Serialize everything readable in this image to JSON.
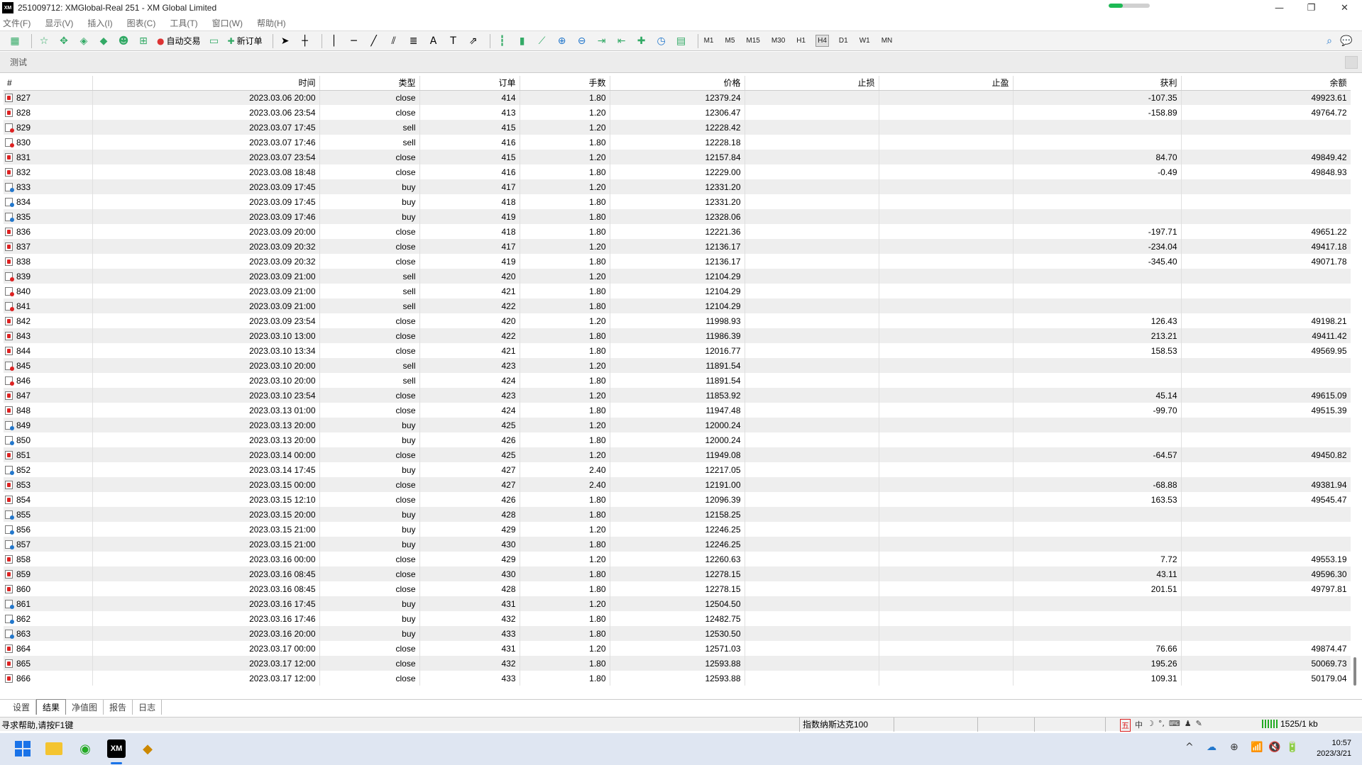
{
  "window": {
    "title": "251009712: XMGlobal-Real 251 - XM Global Limited",
    "logo": "XM",
    "progress": 0.35,
    "minimize_glyph": "—",
    "restore_glyph": "❐",
    "close_glyph": "✕"
  },
  "menu": [
    "文件(F)",
    "显示(V)",
    "插入(I)",
    "图表(C)",
    "工具(T)",
    "窗口(W)",
    "帮助(H)"
  ],
  "toolbar": {
    "autotrade_label": "自动交易",
    "new_order_label": "新订单",
    "text_tool": "A",
    "label_tool": "T",
    "timeframes": [
      "M1",
      "M5",
      "M15",
      "M30",
      "H1",
      "H4",
      "D1",
      "W1",
      "MN"
    ],
    "active_timeframe": "H4"
  },
  "subheader": {
    "label": "测试"
  },
  "table": {
    "columns": [
      "#",
      "时间",
      "类型",
      "订单",
      "手数",
      "价格",
      "止损",
      "止盈",
      "获利",
      "余额"
    ],
    "rows": [
      [
        "827",
        "2023.03.06 20:00",
        "close",
        "414",
        "1.80",
        "12379.24",
        "",
        "",
        "-107.35",
        "49923.61"
      ],
      [
        "828",
        "2023.03.06 23:54",
        "close",
        "413",
        "1.20",
        "12306.47",
        "",
        "",
        "-158.89",
        "49764.72"
      ],
      [
        "829",
        "2023.03.07 17:45",
        "sell",
        "415",
        "1.20",
        "12228.42",
        "",
        "",
        "",
        ""
      ],
      [
        "830",
        "2023.03.07 17:46",
        "sell",
        "416",
        "1.80",
        "12228.18",
        "",
        "",
        "",
        ""
      ],
      [
        "831",
        "2023.03.07 23:54",
        "close",
        "415",
        "1.20",
        "12157.84",
        "",
        "",
        "84.70",
        "49849.42"
      ],
      [
        "832",
        "2023.03.08 18:48",
        "close",
        "416",
        "1.80",
        "12229.00",
        "",
        "",
        "-0.49",
        "49848.93"
      ],
      [
        "833",
        "2023.03.09 17:45",
        "buy",
        "417",
        "1.20",
        "12331.20",
        "",
        "",
        "",
        ""
      ],
      [
        "834",
        "2023.03.09 17:45",
        "buy",
        "418",
        "1.80",
        "12331.20",
        "",
        "",
        "",
        ""
      ],
      [
        "835",
        "2023.03.09 17:46",
        "buy",
        "419",
        "1.80",
        "12328.06",
        "",
        "",
        "",
        ""
      ],
      [
        "836",
        "2023.03.09 20:00",
        "close",
        "418",
        "1.80",
        "12221.36",
        "",
        "",
        "-197.71",
        "49651.22"
      ],
      [
        "837",
        "2023.03.09 20:32",
        "close",
        "417",
        "1.20",
        "12136.17",
        "",
        "",
        "-234.04",
        "49417.18"
      ],
      [
        "838",
        "2023.03.09 20:32",
        "close",
        "419",
        "1.80",
        "12136.17",
        "",
        "",
        "-345.40",
        "49071.78"
      ],
      [
        "839",
        "2023.03.09 21:00",
        "sell",
        "420",
        "1.20",
        "12104.29",
        "",
        "",
        "",
        ""
      ],
      [
        "840",
        "2023.03.09 21:00",
        "sell",
        "421",
        "1.80",
        "12104.29",
        "",
        "",
        "",
        ""
      ],
      [
        "841",
        "2023.03.09 21:00",
        "sell",
        "422",
        "1.80",
        "12104.29",
        "",
        "",
        "",
        ""
      ],
      [
        "842",
        "2023.03.09 23:54",
        "close",
        "420",
        "1.20",
        "11998.93",
        "",
        "",
        "126.43",
        "49198.21"
      ],
      [
        "843",
        "2023.03.10 13:00",
        "close",
        "422",
        "1.80",
        "11986.39",
        "",
        "",
        "213.21",
        "49411.42"
      ],
      [
        "844",
        "2023.03.10 13:34",
        "close",
        "421",
        "1.80",
        "12016.77",
        "",
        "",
        "158.53",
        "49569.95"
      ],
      [
        "845",
        "2023.03.10 20:00",
        "sell",
        "423",
        "1.20",
        "11891.54",
        "",
        "",
        "",
        ""
      ],
      [
        "846",
        "2023.03.10 20:00",
        "sell",
        "424",
        "1.80",
        "11891.54",
        "",
        "",
        "",
        ""
      ],
      [
        "847",
        "2023.03.10 23:54",
        "close",
        "423",
        "1.20",
        "11853.92",
        "",
        "",
        "45.14",
        "49615.09"
      ],
      [
        "848",
        "2023.03.13 01:00",
        "close",
        "424",
        "1.80",
        "11947.48",
        "",
        "",
        "-99.70",
        "49515.39"
      ],
      [
        "849",
        "2023.03.13 20:00",
        "buy",
        "425",
        "1.20",
        "12000.24",
        "",
        "",
        "",
        ""
      ],
      [
        "850",
        "2023.03.13 20:00",
        "buy",
        "426",
        "1.80",
        "12000.24",
        "",
        "",
        "",
        ""
      ],
      [
        "851",
        "2023.03.14 00:00",
        "close",
        "425",
        "1.20",
        "11949.08",
        "",
        "",
        "-64.57",
        "49450.82"
      ],
      [
        "852",
        "2023.03.14 17:45",
        "buy",
        "427",
        "2.40",
        "12217.05",
        "",
        "",
        "",
        ""
      ],
      [
        "853",
        "2023.03.15 00:00",
        "close",
        "427",
        "2.40",
        "12191.00",
        "",
        "",
        "-68.88",
        "49381.94"
      ],
      [
        "854",
        "2023.03.15 12:10",
        "close",
        "426",
        "1.80",
        "12096.39",
        "",
        "",
        "163.53",
        "49545.47"
      ],
      [
        "855",
        "2023.03.15 20:00",
        "buy",
        "428",
        "1.80",
        "12158.25",
        "",
        "",
        "",
        ""
      ],
      [
        "856",
        "2023.03.15 21:00",
        "buy",
        "429",
        "1.20",
        "12246.25",
        "",
        "",
        "",
        ""
      ],
      [
        "857",
        "2023.03.15 21:00",
        "buy",
        "430",
        "1.80",
        "12246.25",
        "",
        "",
        "",
        ""
      ],
      [
        "858",
        "2023.03.16 00:00",
        "close",
        "429",
        "1.20",
        "12260.63",
        "",
        "",
        "7.72",
        "49553.19"
      ],
      [
        "859",
        "2023.03.16 08:45",
        "close",
        "430",
        "1.80",
        "12278.15",
        "",
        "",
        "43.11",
        "49596.30"
      ],
      [
        "860",
        "2023.03.16 08:45",
        "close",
        "428",
        "1.80",
        "12278.15",
        "",
        "",
        "201.51",
        "49797.81"
      ],
      [
        "861",
        "2023.03.16 17:45",
        "buy",
        "431",
        "1.20",
        "12504.50",
        "",
        "",
        "",
        ""
      ],
      [
        "862",
        "2023.03.16 17:46",
        "buy",
        "432",
        "1.80",
        "12482.75",
        "",
        "",
        "",
        ""
      ],
      [
        "863",
        "2023.03.16 20:00",
        "buy",
        "433",
        "1.80",
        "12530.50",
        "",
        "",
        "",
        ""
      ],
      [
        "864",
        "2023.03.17 00:00",
        "close",
        "431",
        "1.20",
        "12571.03",
        "",
        "",
        "76.66",
        "49874.47"
      ],
      [
        "865",
        "2023.03.17 12:00",
        "close",
        "432",
        "1.80",
        "12593.88",
        "",
        "",
        "195.26",
        "50069.73"
      ],
      [
        "866",
        "2023.03.17 12:00",
        "close",
        "433",
        "1.80",
        "12593.88",
        "",
        "",
        "109.31",
        "50179.04"
      ]
    ]
  },
  "tabs": [
    "设置",
    "结果",
    "净值图",
    "报告",
    "日志"
  ],
  "active_tab": "结果",
  "status": {
    "help": "寻求帮助,请按F1键",
    "profile": "指数纳斯达克100",
    "ime": [
      "中",
      "☽",
      "°,",
      "⌨",
      "♟",
      "✎"
    ],
    "connection": "1525/1 kb"
  },
  "taskbar": {
    "xm_label": "XM",
    "time": "10:57",
    "date": "2023/3/21",
    "tray": [
      "^",
      "☁",
      "⊕",
      "📶",
      "🔇",
      "🔋"
    ]
  }
}
